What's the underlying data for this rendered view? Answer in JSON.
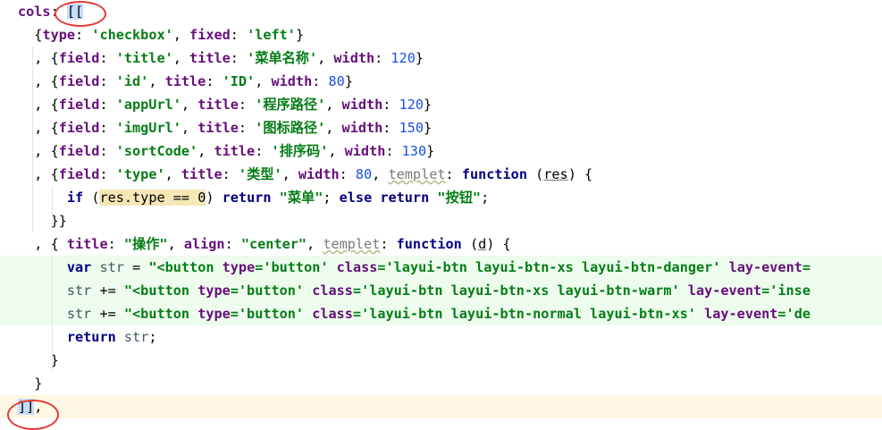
{
  "editor": {
    "lines": [
      {
        "id": "l1",
        "tokens": [
          [
            "p",
            "cols"
          ],
          [
            "d",
            ":"
          ],
          [
            "d",
            " "
          ],
          [
            "d",
            "[["
          ]
        ]
      },
      {
        "id": "l2",
        "tokens": [
          [
            "d",
            "  {"
          ],
          [
            "p",
            "type"
          ],
          [
            "d",
            ": "
          ],
          [
            "s",
            "'checkbox'"
          ],
          [
            "d",
            ", "
          ],
          [
            "p",
            "fixed"
          ],
          [
            "d",
            ": "
          ],
          [
            "s",
            "'left'"
          ],
          [
            "d",
            "}"
          ]
        ]
      },
      {
        "id": "l3",
        "tokens": [
          [
            "d",
            "  , {"
          ],
          [
            "p",
            "field"
          ],
          [
            "d",
            ": "
          ],
          [
            "s",
            "'title'"
          ],
          [
            "d",
            ", "
          ],
          [
            "p",
            "title"
          ],
          [
            "d",
            ": "
          ],
          [
            "s",
            "'菜单名称'"
          ],
          [
            "d",
            ", "
          ],
          [
            "p",
            "width"
          ],
          [
            "d",
            ": "
          ],
          [
            "n",
            "120"
          ],
          [
            "d",
            "}"
          ]
        ]
      },
      {
        "id": "l4",
        "tokens": [
          [
            "d",
            "  , {"
          ],
          [
            "p",
            "field"
          ],
          [
            "d",
            ": "
          ],
          [
            "s",
            "'id'"
          ],
          [
            "d",
            ", "
          ],
          [
            "p",
            "title"
          ],
          [
            "d",
            ": "
          ],
          [
            "s",
            "'ID'"
          ],
          [
            "d",
            ", "
          ],
          [
            "p",
            "width"
          ],
          [
            "d",
            ": "
          ],
          [
            "n",
            "80"
          ],
          [
            "d",
            "}"
          ]
        ]
      },
      {
        "id": "l5",
        "tokens": [
          [
            "d",
            "  , {"
          ],
          [
            "p",
            "field"
          ],
          [
            "d",
            ": "
          ],
          [
            "s",
            "'appUrl'"
          ],
          [
            "d",
            ", "
          ],
          [
            "p",
            "title"
          ],
          [
            "d",
            ": "
          ],
          [
            "s",
            "'程序路径'"
          ],
          [
            "d",
            ", "
          ],
          [
            "p",
            "width"
          ],
          [
            "d",
            ": "
          ],
          [
            "n",
            "120"
          ],
          [
            "d",
            "}"
          ]
        ]
      },
      {
        "id": "l6",
        "tokens": [
          [
            "d",
            "  , {"
          ],
          [
            "p",
            "field"
          ],
          [
            "d",
            ": "
          ],
          [
            "s",
            "'imgUrl'"
          ],
          [
            "d",
            ", "
          ],
          [
            "p",
            "title"
          ],
          [
            "d",
            ": "
          ],
          [
            "s",
            "'图标路径'"
          ],
          [
            "d",
            ", "
          ],
          [
            "p",
            "width"
          ],
          [
            "d",
            ": "
          ],
          [
            "n",
            "150"
          ],
          [
            "d",
            "}"
          ]
        ]
      },
      {
        "id": "l7",
        "tokens": [
          [
            "d",
            "  , {"
          ],
          [
            "p",
            "field"
          ],
          [
            "d",
            ": "
          ],
          [
            "s",
            "'sortCode'"
          ],
          [
            "d",
            ", "
          ],
          [
            "p",
            "title"
          ],
          [
            "d",
            ": "
          ],
          [
            "s",
            "'排序码'"
          ],
          [
            "d",
            ", "
          ],
          [
            "p",
            "width"
          ],
          [
            "d",
            ": "
          ],
          [
            "n",
            "130"
          ],
          [
            "d",
            "}"
          ]
        ]
      },
      {
        "id": "l8",
        "tokens": [
          [
            "d",
            "  , {"
          ],
          [
            "p",
            "field"
          ],
          [
            "d",
            ": "
          ],
          [
            "s",
            "'type'"
          ],
          [
            "d",
            ", "
          ],
          [
            "p",
            "title"
          ],
          [
            "d",
            ": "
          ],
          [
            "s",
            "'类型'"
          ],
          [
            "d",
            ", "
          ],
          [
            "p",
            "width"
          ],
          [
            "d",
            ": "
          ],
          [
            "n",
            "80"
          ],
          [
            "d",
            ", "
          ],
          [
            "u",
            "templet"
          ],
          [
            "d",
            ": "
          ],
          [
            "k",
            "function"
          ],
          [
            "d",
            " ("
          ],
          [
            "wv",
            "res"
          ],
          [
            "d",
            ") {"
          ]
        ]
      },
      {
        "id": "l9",
        "tokens": [
          [
            "d",
            "      "
          ],
          [
            "k",
            "if"
          ],
          [
            "d",
            " ("
          ],
          [
            "hlres",
            "res.type == 0"
          ],
          [
            "d",
            ") "
          ],
          [
            "k",
            "return"
          ],
          [
            "d",
            " "
          ],
          [
            "s",
            "\"菜单\""
          ],
          [
            "d",
            "; "
          ],
          [
            "k",
            "else return"
          ],
          [
            "d",
            " "
          ],
          [
            "s",
            "\"按钮\""
          ],
          [
            "d",
            ";"
          ]
        ]
      },
      {
        "id": "l10",
        "tokens": [
          [
            "d",
            "    }}"
          ]
        ]
      },
      {
        "id": "l11",
        "tokens": [
          [
            "d",
            "  , { "
          ],
          [
            "p",
            "title"
          ],
          [
            "d",
            ": "
          ],
          [
            "s",
            "\"操作\""
          ],
          [
            "d",
            ", "
          ],
          [
            "p",
            "align"
          ],
          [
            "d",
            ": "
          ],
          [
            "s",
            "\"center\""
          ],
          [
            "d",
            ", "
          ],
          [
            "u",
            "templet"
          ],
          [
            "d",
            ": "
          ],
          [
            "k",
            "function"
          ],
          [
            "d",
            " ("
          ],
          [
            "wv",
            "d"
          ],
          [
            "d",
            ") {"
          ]
        ]
      },
      {
        "id": "l12",
        "tokens": [
          [
            "d",
            "      "
          ],
          [
            "k",
            "var"
          ],
          [
            "d",
            " "
          ],
          [
            "v",
            "str"
          ],
          [
            "d",
            " = "
          ],
          [
            "s",
            "\"<button "
          ],
          [
            "p",
            "type"
          ],
          [
            "s",
            "='button' "
          ],
          [
            "p",
            "class"
          ],
          [
            "s",
            "='layui-btn layui-btn-xs layui-btn-danger' "
          ],
          [
            "p",
            "lay-event"
          ],
          [
            "s",
            "="
          ]
        ]
      },
      {
        "id": "l13",
        "tokens": [
          [
            "d",
            "      "
          ],
          [
            "v",
            "str"
          ],
          [
            "d",
            " += "
          ],
          [
            "s",
            "\"<button "
          ],
          [
            "p",
            "type"
          ],
          [
            "s",
            "='button' "
          ],
          [
            "p",
            "class"
          ],
          [
            "s",
            "='layui-btn layui-btn-xs layui-btn-warm' "
          ],
          [
            "p",
            "lay-event"
          ],
          [
            "s",
            "='inse"
          ]
        ]
      },
      {
        "id": "l14",
        "tokens": [
          [
            "d",
            "      "
          ],
          [
            "v",
            "str"
          ],
          [
            "d",
            " += "
          ],
          [
            "s",
            "\"<button "
          ],
          [
            "p",
            "type"
          ],
          [
            "s",
            "='button' "
          ],
          [
            "p",
            "class"
          ],
          [
            "s",
            "='layui-btn layui-btn-normal layui-btn-xs' "
          ],
          [
            "p",
            "lay-event"
          ],
          [
            "s",
            "='de"
          ]
        ]
      },
      {
        "id": "l15",
        "tokens": [
          [
            "d",
            "      "
          ],
          [
            "k",
            "return"
          ],
          [
            "d",
            " "
          ],
          [
            "v",
            "str"
          ],
          [
            "d",
            ";"
          ]
        ]
      },
      {
        "id": "l16",
        "tokens": [
          [
            "d",
            "    }"
          ]
        ]
      },
      {
        "id": "l17",
        "tokens": [
          [
            "d",
            "  }"
          ]
        ]
      },
      {
        "id": "l18",
        "tokens": [
          [
            "d",
            "]]"
          ],
          [
            "d",
            ","
          ]
        ]
      }
    ]
  }
}
